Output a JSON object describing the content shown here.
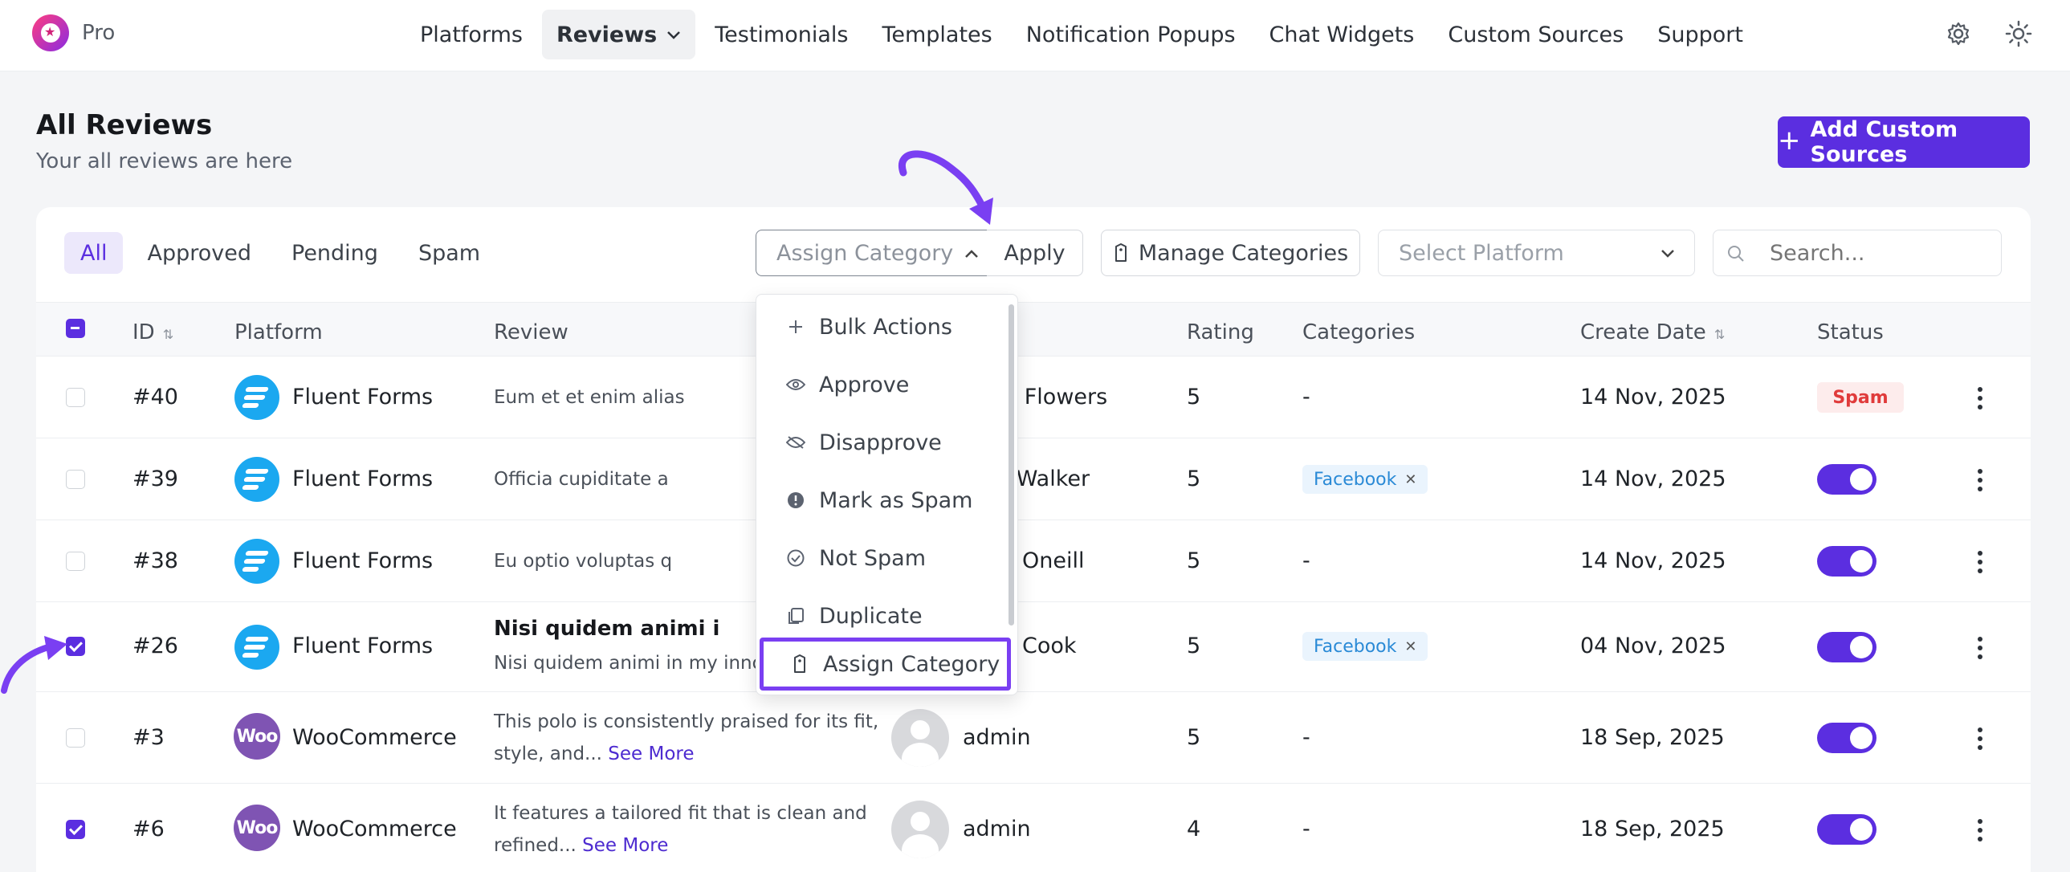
{
  "brand": {
    "label": "Pro"
  },
  "nav": {
    "items": [
      {
        "label": "Platforms"
      },
      {
        "label": "Reviews"
      },
      {
        "label": "Testimonials"
      },
      {
        "label": "Templates"
      },
      {
        "label": "Notification Popups"
      },
      {
        "label": "Chat Widgets"
      },
      {
        "label": "Custom Sources"
      },
      {
        "label": "Support"
      }
    ],
    "active": "Reviews"
  },
  "header": {
    "title": "All Reviews",
    "subtitle": "Your all reviews are here",
    "add_button": "Add Custom Sources"
  },
  "filters": {
    "tabs": [
      {
        "label": "All"
      },
      {
        "label": "Approved"
      },
      {
        "label": "Pending"
      },
      {
        "label": "Spam"
      }
    ],
    "active_tab": "All",
    "bulk_select_value": "Assign Category",
    "apply_label": "Apply",
    "manage_categories_label": "Manage Categories",
    "platform_placeholder": "Select Platform",
    "search_placeholder": "Search..."
  },
  "dropdown": {
    "items": [
      {
        "label": "Bulk Actions",
        "icon": "plus-icon"
      },
      {
        "label": "Approve",
        "icon": "eye-icon"
      },
      {
        "label": "Disapprove",
        "icon": "eye-off-icon"
      },
      {
        "label": "Mark as Spam",
        "icon": "alert-icon"
      },
      {
        "label": "Not Spam",
        "icon": "check-circle-icon"
      },
      {
        "label": "Duplicate",
        "icon": "copy-icon"
      },
      {
        "label": "Assign Category",
        "icon": "tag-icon"
      }
    ],
    "highlighted": "Assign Category"
  },
  "table": {
    "columns": [
      "ID",
      "Platform",
      "Review",
      "Rating",
      "Categories",
      "Create Date",
      "Status"
    ],
    "rows": [
      {
        "id": "#40",
        "platform": "Fluent Forms",
        "review": "Eum et et enim alias",
        "reviewer": "et Flowers",
        "rating": "5",
        "category": "-",
        "date": "14 Nov, 2025",
        "status": "Spam",
        "checked": false
      },
      {
        "id": "#39",
        "platform": "Fluent Forms",
        "review": "Officia cupiditate a",
        "reviewer": "n Walker",
        "rating": "5",
        "category": "Facebook",
        "date": "14 Nov, 2025",
        "status": "on",
        "checked": false
      },
      {
        "id": "#38",
        "platform": "Fluent Forms",
        "review": "Eu optio voluptas q",
        "reviewer": "Oneill",
        "rating": "5",
        "category": "-",
        "date": "14 Nov, 2025",
        "status": "on",
        "checked": false
      },
      {
        "id": "#26",
        "platform": "Fluent Forms",
        "review_title": "Nisi quidem animi i",
        "review": "Nisi quidem animi in my innos.",
        "reviewer": "Cook",
        "rating": "5",
        "category": "Facebook",
        "date": "04 Nov, 2025",
        "status": "on",
        "checked": true
      },
      {
        "id": "#3",
        "platform": "WooCommerce",
        "review_line1": "This polo is consistently praised for its fit,",
        "review_line2": "style, and...",
        "see_more": "See More",
        "reviewer": "admin",
        "rating": "5",
        "category": "-",
        "date": "18 Sep, 2025",
        "status": "on",
        "checked": false
      },
      {
        "id": "#6",
        "platform": "WooCommerce",
        "review_line1": "It features a tailored fit that is clean and",
        "review_line2": "refined...",
        "see_more": "See More",
        "reviewer": "admin",
        "rating": "4",
        "category": "-",
        "date": "18 Sep, 2025",
        "status": "on",
        "checked": true
      }
    ]
  },
  "woo_logo_text": "Woo",
  "colors": {
    "accent": "#5b2ee0",
    "spam": "#e03b3b",
    "category": "#2a8ad6",
    "annotation": "#7a3ff2"
  }
}
